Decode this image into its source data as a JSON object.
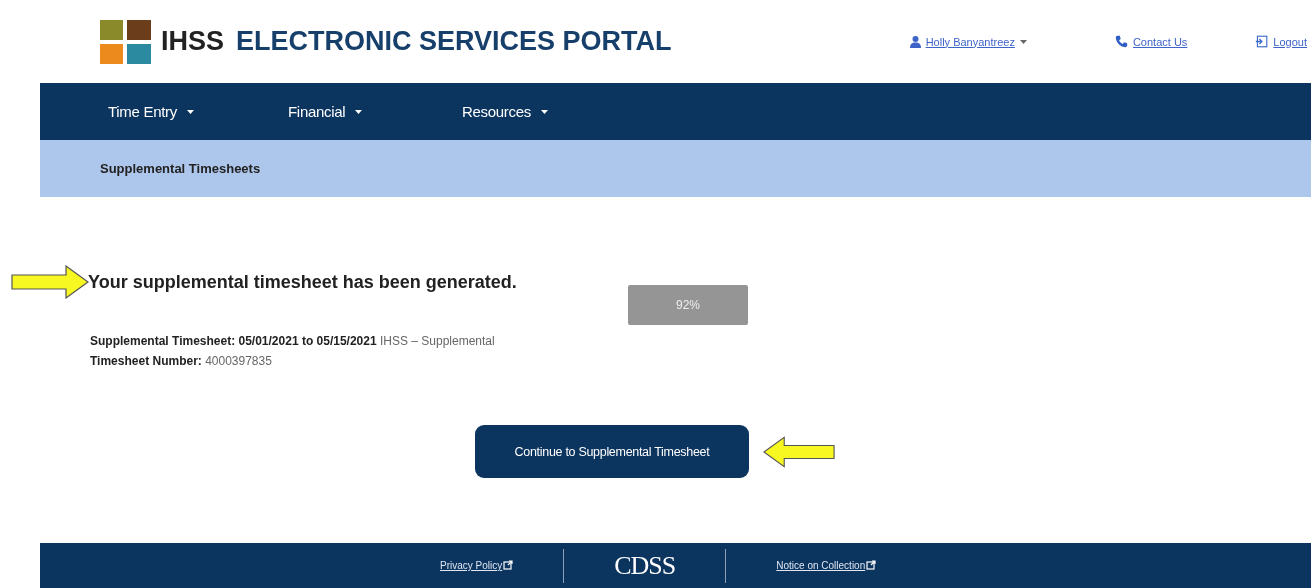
{
  "header": {
    "logo_text": "IHSS",
    "title": "ELECTRONIC SERVICES PORTAL",
    "user": {
      "name": "Holly Banyantreez"
    },
    "links": [
      {
        "kind": "contact",
        "label": "Contact Us"
      },
      {
        "kind": "logout",
        "label": "Logout"
      }
    ]
  },
  "nav": [
    {
      "label": "Time Entry"
    },
    {
      "label": "Financial"
    },
    {
      "label": "Resources"
    }
  ],
  "breadcrumb": "Supplemental Timesheets",
  "message": "Your supplemental timesheet has been generated.",
  "progress_badge": "92%",
  "details": [
    {
      "label": "Supplemental Timesheet:",
      "value": "**05/01/2021 to 05/15/2021** IHSS – Supplemental"
    },
    {
      "label": "Timesheet Number:",
      "value": "4000397835"
    }
  ],
  "continue_button": "Continue to Supplemental Timesheet",
  "footer": {
    "links": [
      {
        "label": "Privacy Policy"
      },
      {
        "label": "Notice on Collection"
      }
    ],
    "logo": "CDSS"
  }
}
